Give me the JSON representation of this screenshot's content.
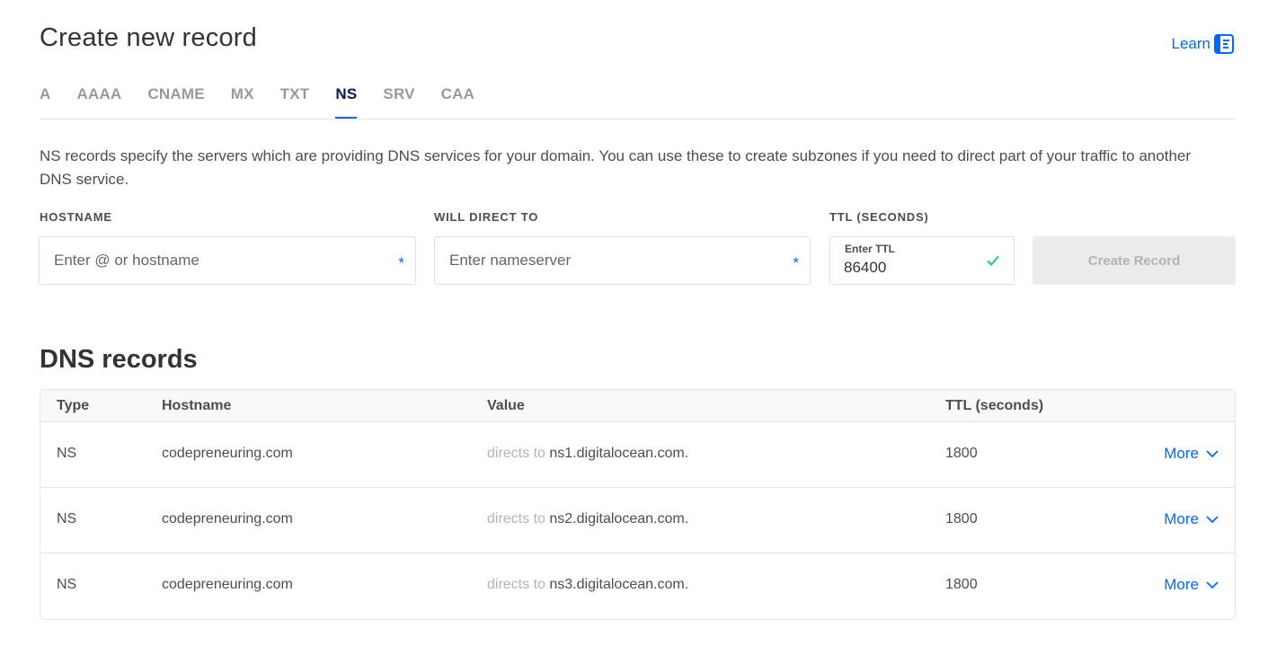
{
  "header": {
    "title": "Create new record",
    "learn_label": "Learn",
    "learn_icon": "book-icon"
  },
  "tabs": [
    {
      "label": "A",
      "active": false
    },
    {
      "label": "AAAA",
      "active": false
    },
    {
      "label": "CNAME",
      "active": false
    },
    {
      "label": "MX",
      "active": false
    },
    {
      "label": "TXT",
      "active": false
    },
    {
      "label": "NS",
      "active": true
    },
    {
      "label": "SRV",
      "active": false
    },
    {
      "label": "CAA",
      "active": false
    }
  ],
  "description": "NS records specify the servers which are providing DNS services for your domain. You can use these to create subzones if you need to direct part of your traffic to another DNS service.",
  "form": {
    "hostname": {
      "label": "HOSTNAME",
      "placeholder": "Enter @ or hostname",
      "value": "",
      "required_mark": "*"
    },
    "direct_to": {
      "label": "WILL DIRECT TO",
      "placeholder": "Enter nameserver",
      "value": "",
      "required_mark": "*"
    },
    "ttl": {
      "label": "TTL (SECONDS)",
      "mini_label": "Enter TTL",
      "value": "86400",
      "valid_icon": "check-icon"
    },
    "submit_label": "Create Record"
  },
  "records_section": {
    "title": "DNS records",
    "columns": [
      "Type",
      "Hostname",
      "Value",
      "TTL (seconds)"
    ],
    "rows": [
      {
        "type": "NS",
        "hostname": "codepreneuring.com",
        "value_prefix": "directs to",
        "value": "ns1.digitalocean.com.",
        "ttl": "1800",
        "more_label": "More"
      },
      {
        "type": "NS",
        "hostname": "codepreneuring.com",
        "value_prefix": "directs to",
        "value": "ns2.digitalocean.com.",
        "ttl": "1800",
        "more_label": "More"
      },
      {
        "type": "NS",
        "hostname": "codepreneuring.com",
        "value_prefix": "directs to",
        "value": "ns3.digitalocean.com.",
        "ttl": "1800",
        "more_label": "More"
      }
    ]
  },
  "colors": {
    "accent": "#0069ff",
    "active_tab_text": "#031b4e",
    "valid_green": "#15cd72",
    "disabled_button_bg": "#ebebeb"
  }
}
